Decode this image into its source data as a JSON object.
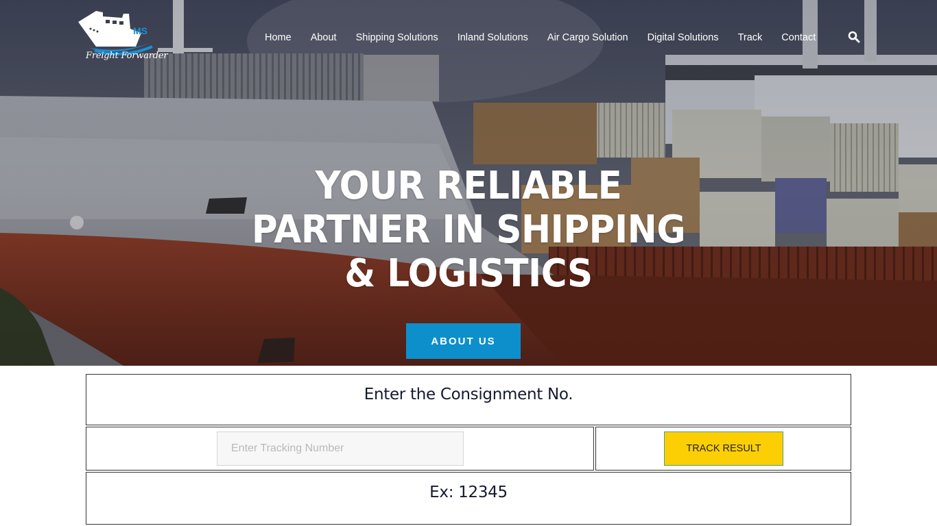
{
  "brand": {
    "logo_letters": "MS",
    "logo_text": "Freight Forwarder",
    "accent_blue": "#0d8fcb",
    "logo_blue": "#1a8fd6"
  },
  "nav": {
    "items": [
      {
        "label": "Home"
      },
      {
        "label": "About"
      },
      {
        "label": "Shipping Solutions"
      },
      {
        "label": "Inland Solutions"
      },
      {
        "label": "Air Cargo Solution"
      },
      {
        "label": "Digital Solutions"
      },
      {
        "label": "Track"
      },
      {
        "label": "Contact"
      }
    ],
    "search_icon": "search-icon"
  },
  "hero": {
    "headline_lines": [
      "YOUR RELIABLE",
      "PARTNER IN SHIPPING",
      "& LOGISTICS"
    ],
    "cta_label": "ABOUT US",
    "background_description": "container ship with red hull and stacked containers"
  },
  "tracking": {
    "title": "Enter the Consignment No.",
    "input_placeholder": "Enter Tracking Number",
    "input_value": "",
    "button_label": "TRACK RESULT",
    "button_color": "#fccf05",
    "example": "Ex: 12345"
  }
}
